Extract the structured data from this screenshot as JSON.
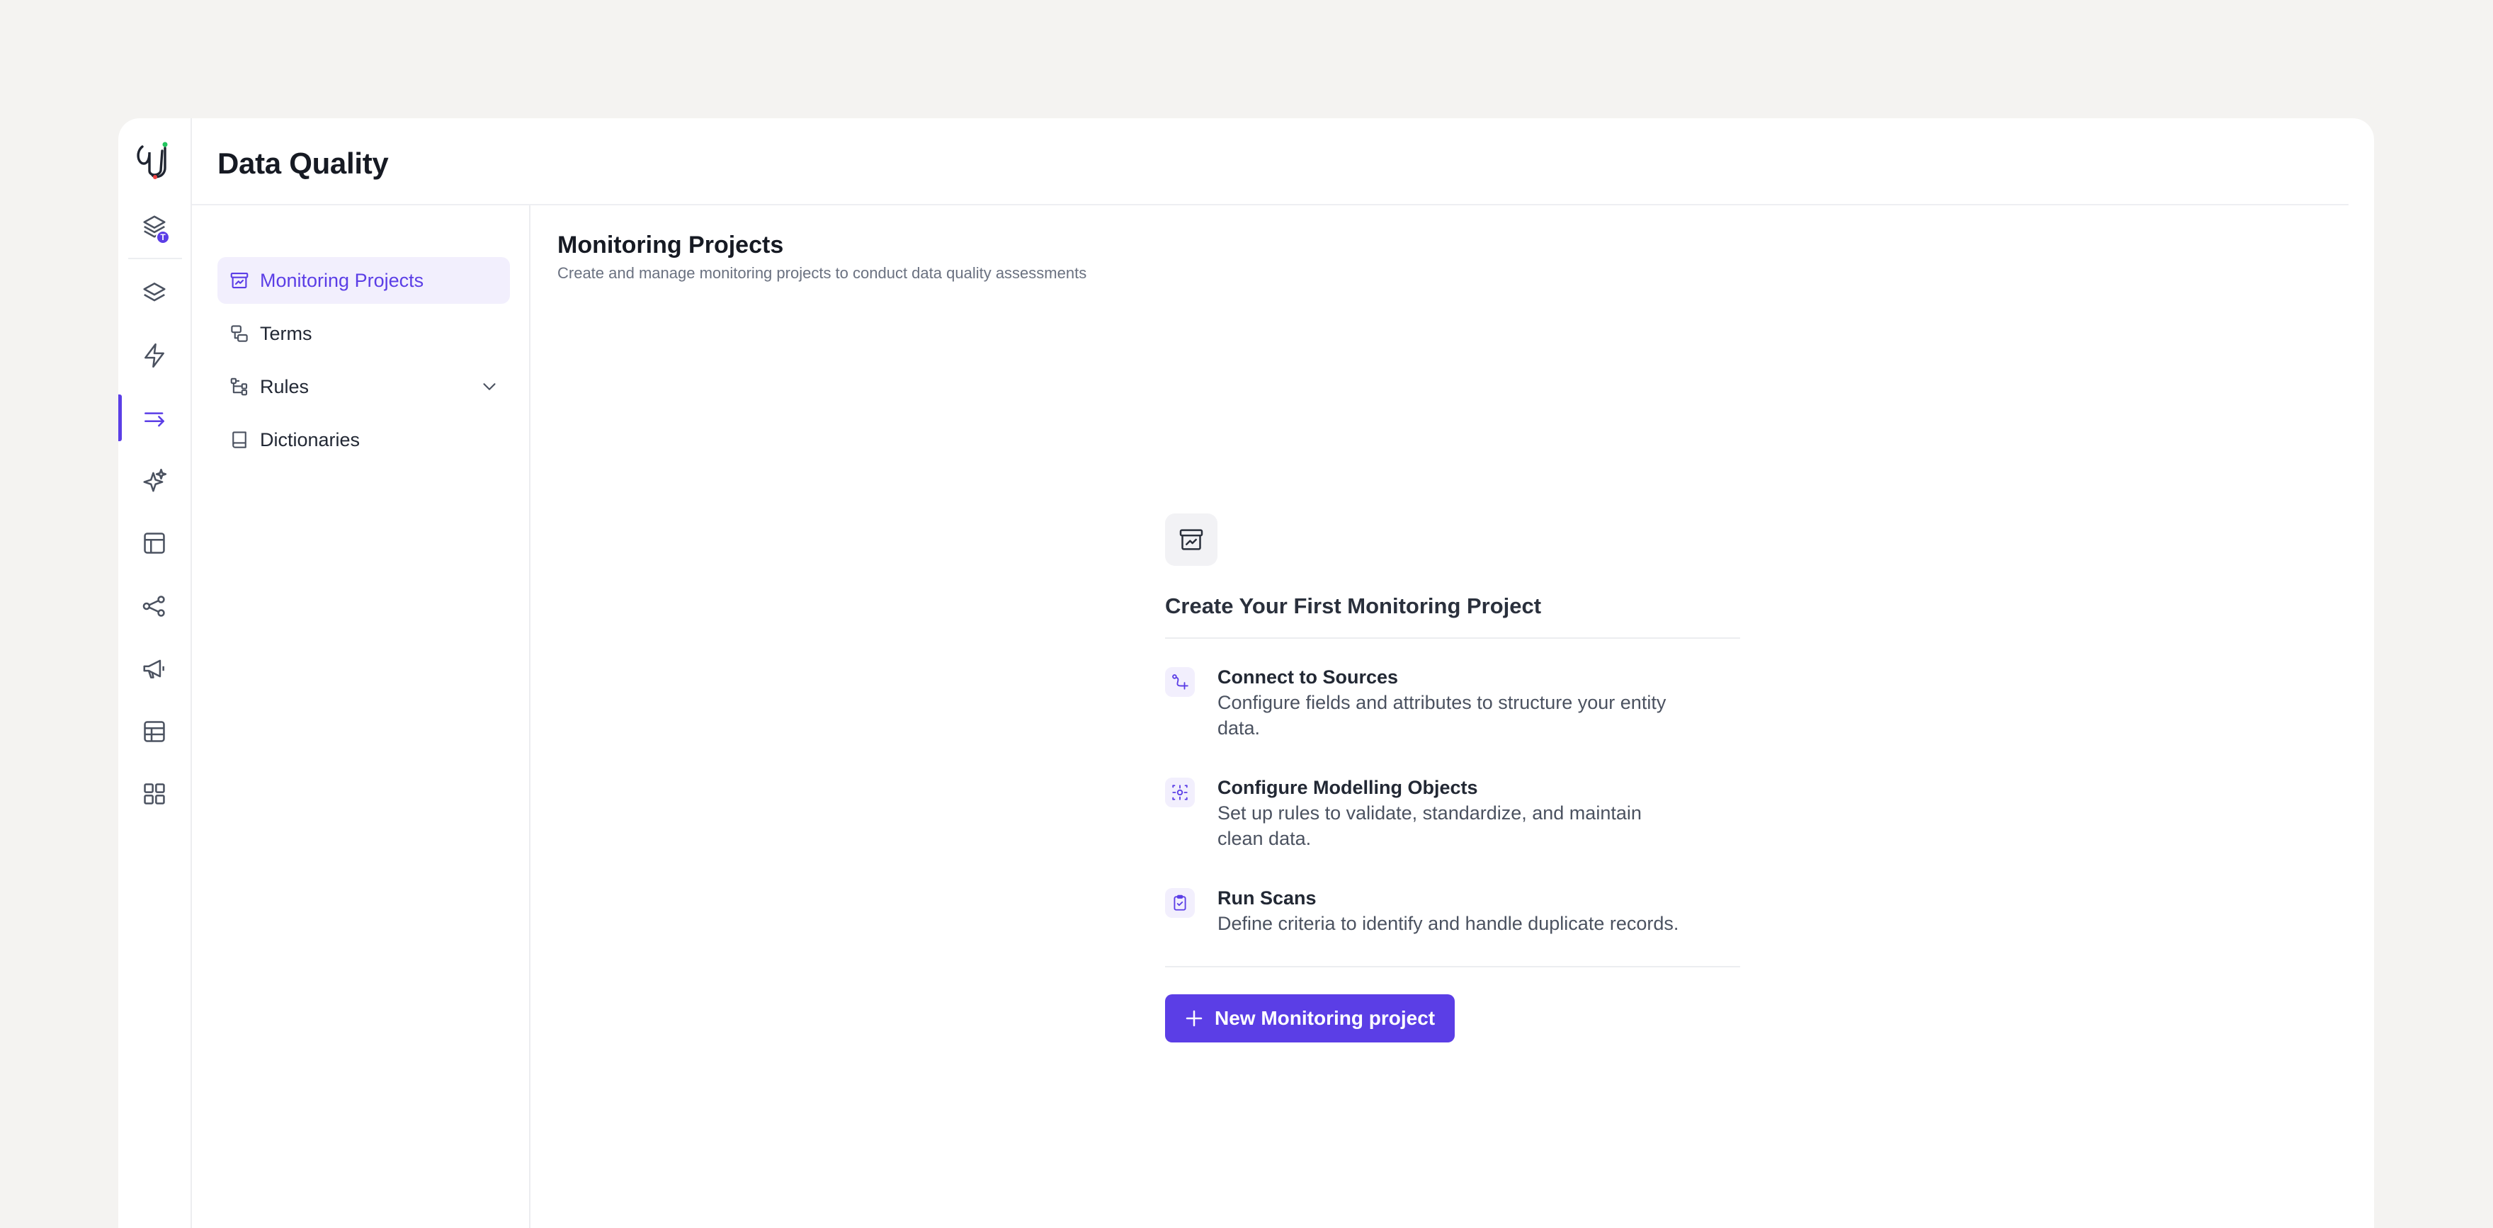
{
  "header": {
    "title": "Data Quality"
  },
  "rail": {
    "badge": "T",
    "items": [
      {
        "icon": "layers-badge-icon"
      },
      {
        "icon": "layers-icon"
      },
      {
        "icon": "lightning-icon"
      },
      {
        "icon": "arrow-right-flow-icon",
        "active": true
      },
      {
        "icon": "sparkles-icon"
      },
      {
        "icon": "layout-icon"
      },
      {
        "icon": "share-nodes-icon"
      },
      {
        "icon": "megaphone-icon"
      },
      {
        "icon": "table-icon"
      },
      {
        "icon": "grid-icon"
      }
    ]
  },
  "subnav": {
    "items": [
      {
        "label": "Monitoring Projects",
        "icon": "archive-chart-icon",
        "active": true
      },
      {
        "label": "Terms",
        "icon": "terms-icon"
      },
      {
        "label": "Rules",
        "icon": "rules-tree-icon",
        "expandable": true
      },
      {
        "label": "Dictionaries",
        "icon": "book-icon"
      }
    ]
  },
  "main": {
    "title": "Monitoring Projects",
    "subtitle": "Create and manage monitoring projects to conduct data quality assessments",
    "empty_state": {
      "title": "Create Your First Monitoring Project",
      "steps": [
        {
          "title": "Connect to Sources",
          "desc": "Configure fields and attributes to structure your entity data."
        },
        {
          "title": "Configure Modelling Objects",
          "desc": "Set up rules to validate, standardize, and maintain clean data."
        },
        {
          "title": "Run Scans",
          "desc": "Define criteria to identify and handle duplicate records."
        }
      ],
      "button_label": "New Monitoring project"
    }
  },
  "colors": {
    "accent": "#5b3ee6",
    "background": "#f4f3f1"
  }
}
